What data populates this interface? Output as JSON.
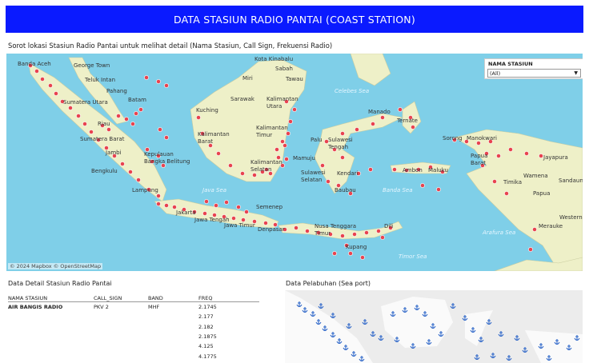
{
  "header": {
    "title": "DATA STASIUN RADIO PANTAI (COAST STATION)"
  },
  "map_section": {
    "instruction": "Sorot lokasi Stasiun Radio Pantai untuk melihat detail (Nama Stasiun, Call Sign, Frekuensi Radio)",
    "attribution": "© 2024 Mapbox  © OpenStreetMap",
    "filter": {
      "title": "NAMA STASIUN",
      "selected": "(All)"
    },
    "place_labels": [
      "Banda Aceh",
      "George Town",
      "Teluk Intan",
      "Pahang",
      "Sumatera Utara",
      "Riau",
      "Sumatera Barat",
      "Jambi",
      "Bengkulu",
      "Lampung",
      "Batam",
      "Kepulauan Bangka Belitung",
      "Jakarta",
      "Jawa Tengah",
      "Jawa Timur",
      "Kota Kinabalu",
      "Sabah",
      "Miri",
      "Tawau",
      "Sarawak",
      "Kalimantan Utara",
      "Kuching",
      "Kalimantan Barat",
      "Kalimantan Timur",
      "Kalimantan Selatan",
      "Semenep",
      "Denpasar",
      "Nusa Tenggara Timur",
      "Kupang",
      "Dili",
      "Palu",
      "Sulawesi Tengah",
      "Manado",
      "Ternate",
      "Mamuju",
      "Sulawesi Selatan",
      "Kendari",
      "Baubau",
      "Ambon",
      "Maluku",
      "Sorong",
      "Manokwari",
      "Papua Barat",
      "Jayapura",
      "Wamena",
      "Timika",
      "Papua",
      "Merauke",
      "Sandaun",
      "Western"
    ],
    "sea_labels": [
      "Celebes Sea",
      "Java Sea",
      "Banda Sea",
      "Arafura Sea",
      "Timor Sea"
    ]
  },
  "detail_section": {
    "title": "Data Detail Stasiun Radio  Pantai",
    "columns": [
      "NAMA STASIUN",
      "CALL_SIGN",
      "BAND",
      "FREQ"
    ],
    "rows": [
      {
        "name": "AIR BANGIS RADIO",
        "call_sign": "PKV 2",
        "band": "MHF",
        "freq": "2.1745"
      },
      {
        "name": "",
        "call_sign": "",
        "band": "",
        "freq": "2.177"
      },
      {
        "name": "",
        "call_sign": "",
        "band": "",
        "freq": "2.182"
      },
      {
        "name": "",
        "call_sign": "",
        "band": "",
        "freq": "2.1875"
      },
      {
        "name": "",
        "call_sign": "",
        "band": "",
        "freq": "4.125"
      },
      {
        "name": "",
        "call_sign": "",
        "band": "",
        "freq": "4.1775"
      }
    ]
  },
  "port_section": {
    "title": "Data Pelabuhan (Sea port)"
  },
  "colors": {
    "banner": "#0a1aff",
    "sea": "#7fcfe8",
    "land": "#eef0c8",
    "station_dot": "#e8434f",
    "port_icon": "#2a64c8"
  }
}
